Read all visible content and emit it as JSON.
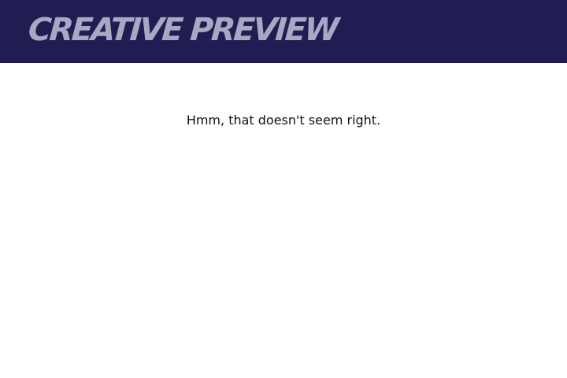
{
  "header": {
    "brand": "CREATIVE PREVIEW",
    "background_color": "#1f1d52",
    "brand_color": "#a9a8c3"
  },
  "main": {
    "message": "Hmm, that doesn't seem right."
  }
}
